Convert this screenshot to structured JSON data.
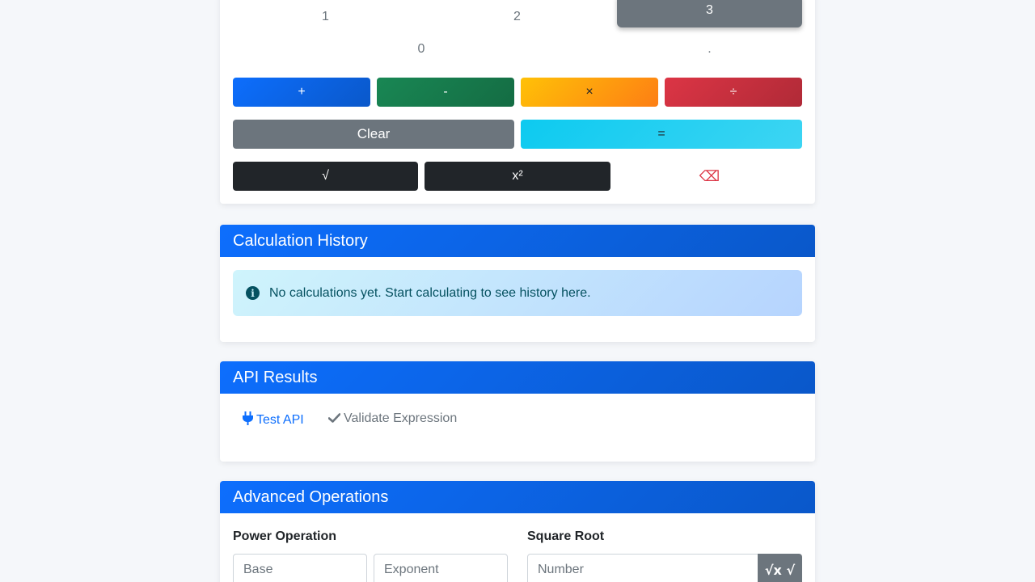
{
  "keypad": {
    "row3": [
      "1",
      "2",
      "3"
    ],
    "row4": [
      "0",
      "."
    ],
    "ops": {
      "plus": "+",
      "minus": "-",
      "multiply": "×",
      "divide": "÷"
    },
    "clear": "Clear",
    "equals": "=",
    "sqrt": "√",
    "square": "x²",
    "backspace": "⌫"
  },
  "history": {
    "title": "Calculation History",
    "empty_message": "No calculations yet. Start calculating to see history here.",
    "info_icon": "i"
  },
  "api": {
    "title": "API Results",
    "test_label": "Test API",
    "validate_label": "Validate Expression"
  },
  "advanced": {
    "title": "Advanced Operations",
    "power_label": "Power Operation",
    "base_placeholder": "Base",
    "exponent_placeholder": "Exponent",
    "sqrt_label": "Square Root",
    "number_placeholder": "Number",
    "sqrt_button": "√x √"
  },
  "colors": {
    "primary": "#0d6efd",
    "success": "#198754",
    "warning": "#ffc107",
    "danger": "#dc3545",
    "secondary": "#6c757d",
    "info": "#0dcaf0",
    "dark": "#212529"
  },
  "icons": {
    "test_api": "plug-icon",
    "validate": "check-icon",
    "info": "info-circle-icon",
    "backspace": "backspace-icon"
  }
}
